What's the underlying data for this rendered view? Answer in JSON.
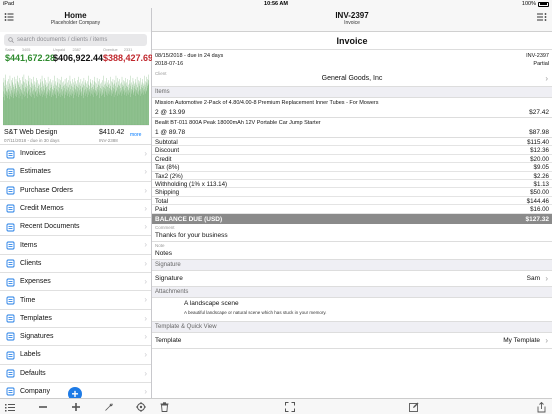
{
  "status": {
    "device": "iPad",
    "time": "10:56 AM",
    "battery": "100%"
  },
  "left": {
    "title": "Home",
    "subtitle": "Placeholder Company",
    "search_placeholder": "search documents / clients / items",
    "stats": [
      {
        "label": "Sales",
        "count": "3405",
        "value": "$441,672.28",
        "color": "#2e8b2e"
      },
      {
        "label": "Unpaid",
        "count": "2387",
        "value": "$406,922.44",
        "color": "#111111"
      },
      {
        "label": "Overdue",
        "count": "2331",
        "value": "$388,427.69",
        "color": "#c0272d"
      }
    ],
    "chart_data": {
      "type": "bar",
      "color": "#5aa35a",
      "values": [
        38,
        25,
        30,
        42,
        28,
        35,
        22,
        40,
        33,
        27,
        45,
        30,
        26,
        36,
        31,
        24,
        39,
        29,
        34,
        41,
        27,
        32,
        23,
        37,
        30,
        44,
        26,
        35,
        28,
        33,
        40,
        25,
        31,
        38,
        29,
        42,
        27,
        34,
        36,
        24,
        30,
        43,
        28,
        32,
        37,
        26,
        35,
        41,
        29,
        33,
        25,
        39,
        31,
        44,
        27,
        36,
        30,
        38,
        24,
        34,
        28,
        42,
        32,
        26,
        40,
        35,
        29,
        37,
        31,
        23,
        36,
        43,
        28,
        33,
        39,
        27,
        45,
        30,
        25,
        38,
        32,
        34,
        41,
        26,
        29,
        37,
        33,
        40,
        28,
        35,
        24,
        31,
        39,
        30,
        44,
        27,
        36,
        32,
        42,
        26,
        34,
        29,
        38,
        33,
        25,
        41,
        30,
        37,
        28,
        35,
        31,
        43,
        27,
        32,
        36,
        24,
        39,
        30,
        29,
        34,
        38,
        26,
        42,
        31,
        33,
        28,
        40,
        25,
        35,
        30,
        37,
        32,
        27,
        36,
        29,
        41,
        33,
        26,
        38,
        31,
        34,
        28,
        44,
        30,
        25,
        39,
        35,
        32,
        27,
        37,
        29,
        42,
        31,
        26,
        36,
        33,
        40,
        28,
        34,
        24,
        38,
        30,
        35,
        27,
        43,
        32,
        29,
        37,
        26,
        39,
        31,
        28,
        33,
        41,
        30,
        36,
        25,
        34,
        38,
        27,
        32,
        29,
        40,
        35,
        26,
        31,
        37,
        44,
        28,
        33,
        30,
        39,
        27,
        36,
        24,
        35,
        32,
        42,
        29,
        31,
        38,
        26,
        34,
        30,
        41,
        28,
        37,
        33,
        25,
        36,
        40,
        29,
        32,
        27,
        43,
        34,
        30,
        38,
        26,
        35,
        31,
        39,
        28,
        33,
        36,
        24,
        41,
        30,
        37,
        27,
        32,
        42,
        29,
        35,
        26,
        38,
        31,
        34,
        28,
        40,
        33,
        25,
        36,
        30,
        44,
        27,
        39,
        32,
        29,
        35,
        37,
        26,
        31,
        41,
        28,
        34,
        30,
        38,
        24,
        33,
        36,
        27,
        42,
        29,
        32,
        39,
        31,
        35,
        26,
        37,
        28,
        40,
        30,
        34,
        25,
        43,
        33,
        36,
        27,
        38,
        31,
        29,
        35,
        32,
        41,
        26,
        37,
        30,
        28,
        39,
        34,
        33,
        27,
        36,
        24,
        42,
        31,
        35,
        29,
        38,
        32,
        26,
        40,
        30,
        37,
        28,
        34,
        33,
        25,
        39,
        31,
        36,
        27,
        44,
        30,
        35,
        32,
        29,
        38,
        26,
        41,
        33,
        28,
        37,
        31,
        34,
        27,
        40,
        30,
        36,
        25,
        32,
        39,
        29,
        35,
        43,
        31,
        28,
        38,
        33,
        26,
        37,
        30,
        42,
        27,
        34,
        32,
        36,
        29,
        39,
        31,
        24,
        35,
        41,
        28,
        33,
        37,
        30,
        26,
        38,
        32,
        35,
        27,
        40,
        29,
        34,
        31,
        44,
        28,
        36,
        33,
        25,
        39,
        30,
        37,
        32,
        27,
        42,
        35,
        29,
        38,
        26,
        34,
        31,
        36,
        40,
        28,
        33,
        30,
        37,
        27,
        43,
        32,
        35,
        29,
        39,
        31,
        26,
        38,
        34,
        28,
        41,
        30,
        36,
        33,
        25,
        37,
        32,
        40,
        27,
        35,
        29,
        44,
        31,
        38,
        30,
        34,
        26,
        42,
        33,
        36,
        28,
        39,
        32,
        35,
        27,
        41,
        30,
        37,
        29,
        33,
        38,
        26,
        31,
        43,
        34,
        28,
        36,
        40,
        30,
        35,
        32,
        27,
        39,
        31,
        37,
        29,
        42,
        33,
        26,
        38,
        35,
        30,
        34,
        28,
        41,
        32,
        36,
        31,
        27,
        40,
        33,
        29,
        37,
        25,
        35,
        44,
        30,
        38,
        32,
        28,
        36,
        34,
        31,
        42,
        29,
        39,
        27,
        33,
        37,
        30,
        35,
        26,
        41,
        32,
        38,
        31,
        29,
        36,
        43,
        28,
        34,
        33,
        30,
        40,
        27,
        37,
        35,
        31,
        39,
        32,
        26,
        42,
        30,
        36,
        34,
        28,
        38,
        33,
        29,
        41,
        31,
        35,
        27,
        37,
        30,
        44,
        32,
        36,
        28,
        39,
        34,
        31,
        43,
        30,
        38,
        35,
        33,
        41,
        37,
        40,
        36,
        45
      ]
    },
    "recent": {
      "name": "S&T Web Design",
      "amount": "$410.42",
      "date": "07/11/2018 - due in 30 days",
      "number": "INV-2388",
      "more": "more"
    },
    "menu": [
      {
        "label": "Invoices",
        "icon": "invoices-icon"
      },
      {
        "label": "Estimates",
        "icon": "estimates-icon"
      },
      {
        "label": "Purchase Orders",
        "icon": "purchase-orders-icon"
      },
      {
        "label": "Credit Memos",
        "icon": "credit-memos-icon"
      },
      {
        "label": "Recent Documents",
        "icon": "recent-documents-icon"
      },
      {
        "label": "Items",
        "icon": "items-icon"
      },
      {
        "label": "Clients",
        "icon": "clients-icon"
      },
      {
        "label": "Expenses",
        "icon": "expenses-icon"
      },
      {
        "label": "Time",
        "icon": "time-icon"
      },
      {
        "label": "Templates",
        "icon": "templates-icon"
      },
      {
        "label": "Signatures",
        "icon": "signatures-icon"
      },
      {
        "label": "Labels",
        "icon": "labels-icon"
      },
      {
        "label": "Defaults",
        "icon": "defaults-icon"
      },
      {
        "label": "Company",
        "icon": "company-icon"
      }
    ],
    "toolbar": [
      "list-icon",
      "minus-icon",
      "plus-icon",
      "wrench-icon",
      "target-icon"
    ]
  },
  "right": {
    "title": "INV-2397",
    "subtitle": "Invoice",
    "doc_title": "Invoice",
    "date_line": "08/15/2018 - due in 24 days",
    "number": "INV-2397",
    "created": "2018-07-16",
    "status": "Partial",
    "client_label": "Client",
    "client_name": "General Goods, Inc",
    "items_header": "Items",
    "items": [
      {
        "description": "Mission Automotive 2-Pack of 4.80/4.00-8 Premium Replacement Inner Tubes - For Mowers",
        "qty": "2 @ 13.99",
        "amount": "$27.42"
      },
      {
        "description": "Bealit BT-011 800A Peak 18000mAh 12V Portable Car Jump Starter",
        "qty": "1 @ 89.78",
        "amount": "$87.98"
      }
    ],
    "summary": [
      {
        "label": "Subtotal",
        "value": "$115.40"
      },
      {
        "label": "Discount",
        "value": "$12.36"
      },
      {
        "label": "Credit",
        "value": "$20.00"
      },
      {
        "label": "Tax (8%)",
        "value": "$9.05"
      },
      {
        "label": "Tax2 (2%)",
        "value": "$2.26"
      },
      {
        "label": "Withholding (1% x 113.14)",
        "value": "$1.13"
      },
      {
        "label": "Shipping",
        "value": "$50.00"
      },
      {
        "label": "Total",
        "value": "$144.46"
      },
      {
        "label": "Paid",
        "value": "$16.00"
      }
    ],
    "balance_label": "BALANCE DUE (USD)",
    "balance_value": "$127.32",
    "comment_label": "Comment",
    "comment": "Thanks for your business",
    "note_label": "Note",
    "note": "Notes",
    "signature_header": "Signature",
    "signature_label": "Signature",
    "signature_value": "Sam",
    "attachments_header": "Attachments",
    "attachment_title": "A landscape scene",
    "attachment_desc": "A beautiful landscape or natural scene which has stuck in your memory.",
    "template_header": "Template & Quick View",
    "template_label": "Template",
    "template_value": "My Template",
    "toolbar": [
      "trash-icon",
      "expand-icon",
      "edit-icon",
      "share-icon"
    ]
  }
}
